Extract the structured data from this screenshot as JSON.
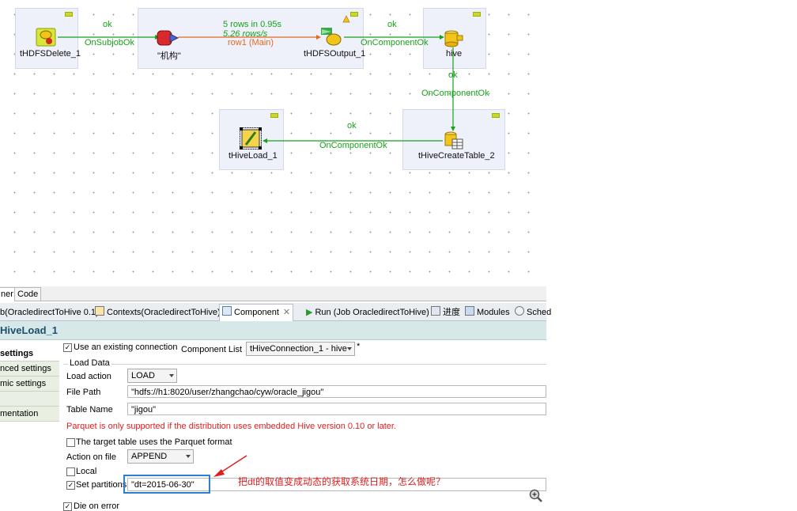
{
  "canvas": {
    "components": {
      "hdfs_delete": "tHDFSDelete_1",
      "jigou": "\"机构\"",
      "hdfs_output": "tHDFSOutput_1",
      "hive": "hive",
      "hive_load": "tHiveLoad_1",
      "hive_create_table": "tHiveCreateTable_2"
    },
    "links": {
      "ok1": "ok",
      "on_subjob_ok": "OnSubjobOk",
      "ok2": "ok",
      "on_component_ok1": "OnComponentOk",
      "ok3": "ok",
      "on_component_ok2": "OnComponentOk",
      "ok4": "ok",
      "on_component_ok3": "OnComponentOk"
    },
    "row_stats": {
      "rows": "5 rows in 0.95s",
      "rate": "5.26 rows/s",
      "row_name": "row1 (Main)"
    }
  },
  "bottom_tabs": [
    "ner",
    "Code"
  ],
  "view_tabs": {
    "job": "b(OracledirectToHive 0.1)",
    "contexts": "Contexts(OracledirectToHive)",
    "component": "Component",
    "run": "Run (Job OracledirectToHive)",
    "progress": "进度",
    "modules": "Modules",
    "sched": "Sched"
  },
  "component_title": "HiveLoad_1",
  "side_items": [
    "settings",
    "nced settings",
    "mic settings",
    "",
    "mentation"
  ],
  "form": {
    "use_existing_connection": "Use an existing connection",
    "component_list_label": "Component List",
    "component_list_value": "tHiveConnection_1 - hive",
    "load_data_group": "Load Data",
    "load_action_label": "Load action",
    "load_action_value": "LOAD",
    "file_path_label": "File Path",
    "file_path_value": "\"hdfs://h1:8020/user/zhangchao/cyw/oracle_jigou\"",
    "table_name_label": "Table Name",
    "table_name_value": "\"jigou\"",
    "parquet_warning": "Parquet is only supported if the distribution uses embedded Hive version 0.10 or later.",
    "parquet_format": "The target table uses the Parquet format",
    "action_on_file_label": "Action on file",
    "action_on_file_value": "APPEND",
    "local_label": "Local",
    "set_partitions_label": "Set partitions",
    "set_partitions_value": "\"dt=2015-06-30\"",
    "die_on_error": "Die on error"
  },
  "annotation": "把dt的取值变成动态的获取系统日期，怎么做呢？",
  "colors": {
    "link_green": "#16a11a",
    "main_row_orange": "#e06a1e",
    "annotation_red": "#e02020",
    "highlight_blue": "#2b7fd4"
  }
}
